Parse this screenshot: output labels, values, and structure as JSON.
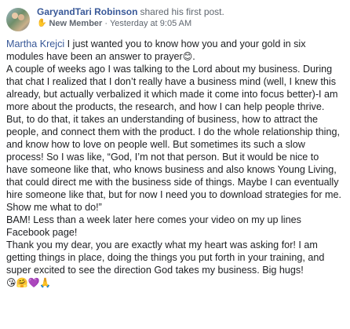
{
  "post": {
    "author": "GaryandTari Robinson",
    "action": "shared his first post.",
    "badge_icon": "wave-hand-icon",
    "badge": "New Member",
    "separator": "·",
    "timestamp": "Yesterday at 9:05 AM"
  },
  "message": {
    "mention": "Martha Krejci",
    "text_after_mention": " I just wanted you to know how you and your gold in six modules have been an answer to prayer",
    "emoji_1": "😊",
    "text_middle": ".\nA couple of weeks ago I was talking to the Lord about my business. During that chat I realized that I don’t really have a business mind (well, I knew this already, but actually verbalized it which made it come into focus better)-I am more about the products, the research, and how I can help people thrive. But, to do that, it takes an understanding of business, how to attract the people, and connect them with the product. I do the whole relationship thing, and know how to love on people well. But sometimes its such a slow process! So I was like, “God, I’m not that person. But it would be nice to have someone like that, who knows business and also knows Young Living, that could direct me with the business side of things. Maybe I can eventually hire someone like that, but for now I need you to download strategies for me. Show me what to do!”\nBAM! Less than a week later here comes your video on my up lines Facebook page!\nThank you my dear, you are exactly what my heart was asking for! I am getting things in place, doing the things you put forth in your training, and super excited to see the direction God takes my business. Big hugs!\n",
    "emoji_end": "😘🤗💜🙏"
  }
}
